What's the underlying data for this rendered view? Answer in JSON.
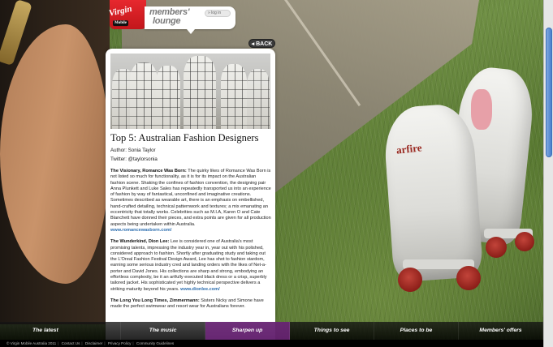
{
  "header": {
    "brand_name": "Virgin",
    "brand_sub": "Mobile",
    "lounge_title_line1": "members'",
    "lounge_title_line2": "lounge",
    "login_label": "» log in"
  },
  "back_label": "BACK",
  "article": {
    "title": "Top 5: Australian Fashion Designers",
    "author": "Author: Sonia Taylor",
    "twitter": "Twitter: @taylorsonia",
    "paragraphs": [
      {
        "lead": "The Visionary, Romance Was Born:",
        "text": " The quirky likes of Romance Was Born is not listed so much for functionality, as it is for its impact on the Australian fashion scene. Shaking the confines of fashion convention, the designing pair Anna Plunkett and Luke Sales has repeatedly transported us into an experience of fashion by way of fantastical, unconfined and imaginative creations. Sometimes described as wearable art, there is an emphasis on embellished, hand-crafted detailing, technical patternwork and textures; a mix emanating an eccentricity that totally works. Celebrities such as M.I.A, Karen O and Cate Blanchett have donned their pieces, and extra points are given for all production aspects being undertaken within Australia.",
        "link": "www.romancewasborn.com/"
      },
      {
        "lead": "The Wunderkind, Dion Lee:",
        "text": " Lee is considered one of Australia's most promising talents, impressing the industry year in, year out with his polished, considered approach to fashion. Shortly after graduating study and taking out the L'Oreal Fashion Festival Design Award, Lee has shot to fashion stardom, earning some serious industry cred and landing orders with the likes of Net-a-porter and David Jones. His collections are sharp and strong, embodying an effortless complexity, be it an artfully executed black dress or a crisp, superbly tailored jacket. His sophisticated yet highly technical perspective delivers a striking maturity beyond his years.",
        "link": "www.dionlee.com/"
      },
      {
        "lead": "The Long You Long Times, Zimmermann:",
        "text": " Sisters Nicky and Simone have made the perfect swimwear and resort wear for Australians forever.",
        "link": ""
      }
    ]
  },
  "nav": {
    "items": [
      "The latest",
      "The music",
      "Sharpen up",
      "Things to see",
      "Places to be",
      "Members' offers"
    ],
    "active_index": 2,
    "active_color": "#7d288c"
  },
  "footer": {
    "links": [
      "© Virgin Mobile Australia 2011",
      "Contact Us",
      "Disclaimer",
      "Privacy Policy",
      "Community Guidelines"
    ]
  },
  "background": {
    "skate_brand_text": "arfire"
  },
  "colors": {
    "brand_red": "#e7282e",
    "link_blue": "#2e6fb0"
  }
}
